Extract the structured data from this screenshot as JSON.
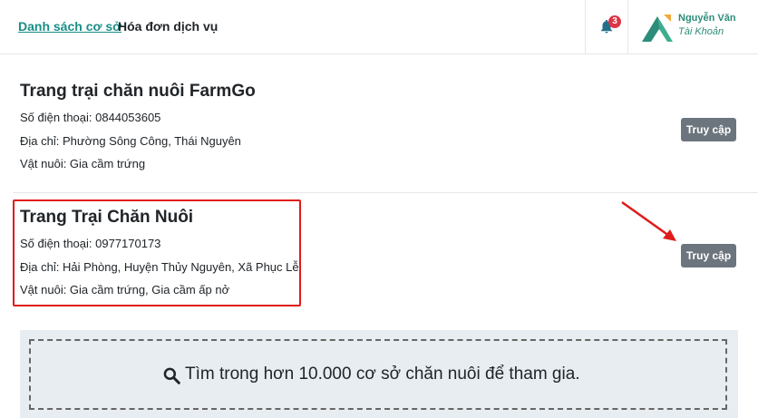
{
  "header": {
    "nav": {
      "facilities_label": "Danh sách cơ sở",
      "invoices_label": "Hóa đơn dịch vụ"
    },
    "notifications": {
      "icon": "bell-icon",
      "count": "3"
    },
    "user": {
      "name": "Nguyễn Văn",
      "role": "Tài Khoản",
      "logo": "mountain-logo"
    }
  },
  "farms": [
    {
      "title": "Trang trại chăn nuôi FarmGo",
      "phone": "Số điện thoại: 0844053605",
      "address": "Địa chỉ: Phường Sông Công, Thái Nguyên",
      "livestock": "Vật nuôi: Gia cầm trứng",
      "action_label": "Truy cập"
    },
    {
      "title": "Trang Trại Chăn Nuôi",
      "phone": "Số điện thoại: 0977170173",
      "address": "Địa chỉ: Hải Phòng, Huyện Thủy Nguyên, Xã Phục Lễ",
      "livestock": "Vật nuôi: Gia cầm trứng, Gia cầm ấp nở",
      "action_label": "Truy cập"
    }
  ],
  "search": {
    "icon": "search-icon",
    "text": "Tìm trong hơn 10.000 cơ sở chăn nuôi để tham gia."
  },
  "colors": {
    "accent": "#1a8f86",
    "button": "#6c757d",
    "badge": "#dc3545",
    "annotation": "#e01b1b",
    "panel": "#e8edf1"
  }
}
